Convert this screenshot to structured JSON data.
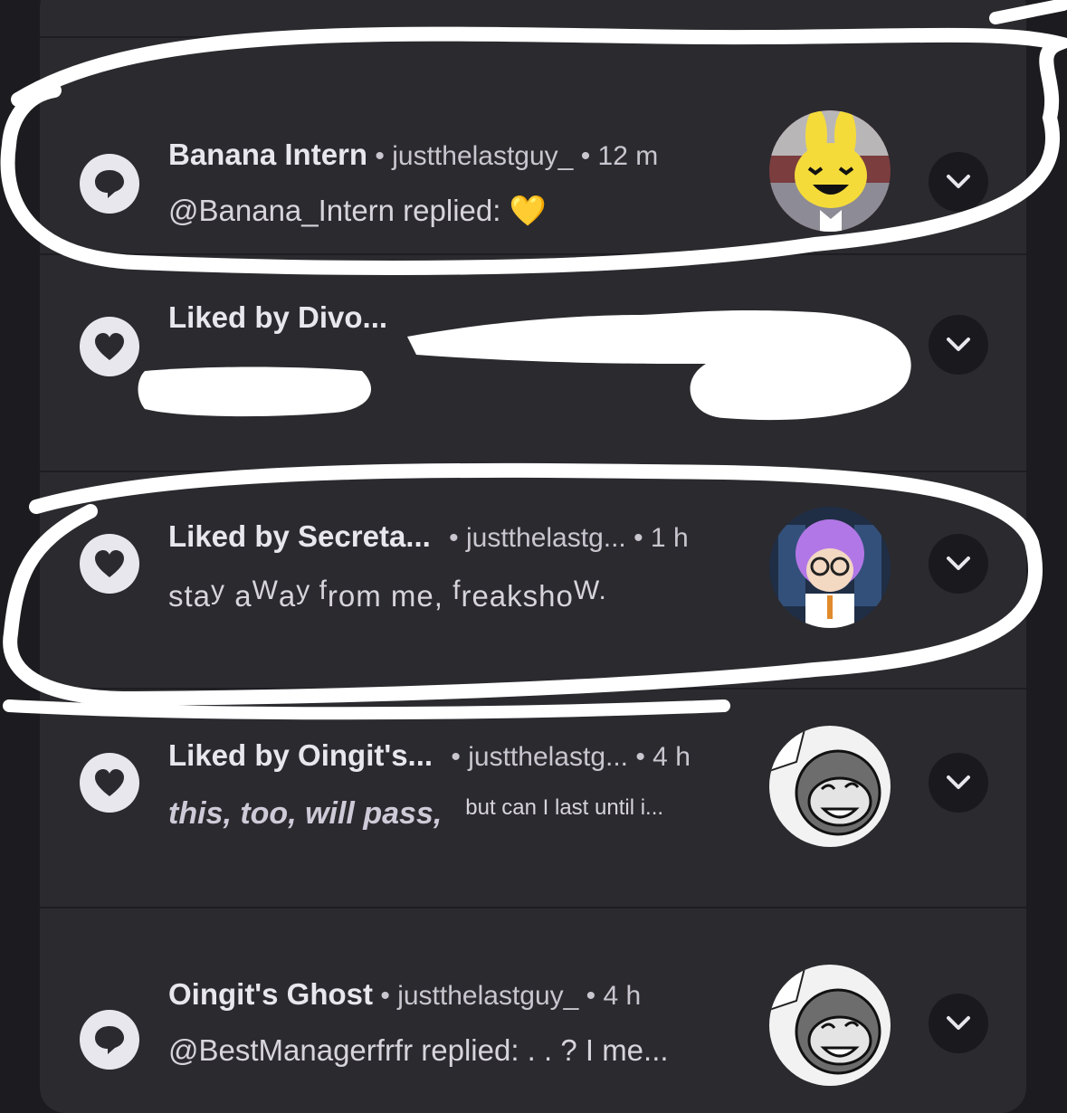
{
  "notifications": [
    {
      "kind": "reply",
      "icon": "speech-bubble-icon",
      "name": "Banana Intern",
      "sep1": " • ",
      "meta": "justthelastguy_ • 12 m",
      "body": "@Banana_Intern replied: 💛",
      "avatar": "yellow-bunny-avatar"
    },
    {
      "kind": "like",
      "icon": "heart-icon",
      "name": "Liked by Divo...",
      "meta": "",
      "body": "",
      "avatar": "redacted-avatar"
    },
    {
      "kind": "like",
      "icon": "heart-icon",
      "name": "Liked by Secreta...",
      "sep1": " • ",
      "meta": "justthelastg... • 1 h",
      "body_parts": [
        "sta",
        "y",
        " a",
        "W",
        "a",
        "y",
        " f",
        "rom me, ",
        "f",
        "reaksho",
        "W."
      ],
      "avatar": "purple-hair-avatar"
    },
    {
      "kind": "like",
      "icon": "heart-icon",
      "name": "Liked by Oingit's...",
      "sep1": " • ",
      "meta": "justthelastg... • 4 h",
      "body_a": "this, too, will pass,",
      "body_b": "but can I last until i...",
      "avatar": "monkey-comic-avatar"
    },
    {
      "kind": "reply",
      "icon": "speech-bubble-icon",
      "name": "Oingit's Ghost",
      "sep1": " • ",
      "meta": "justthelastguy_ • 4 h",
      "body": "@BestManagerfrfr replied: . . ? I me...",
      "avatar": "monkey-comic-avatar"
    }
  ],
  "colors": {
    "background": "#1c1b1f",
    "panel": "#2b2a2f",
    "text": "#e9e7ee",
    "annotation": "#ffffff"
  }
}
